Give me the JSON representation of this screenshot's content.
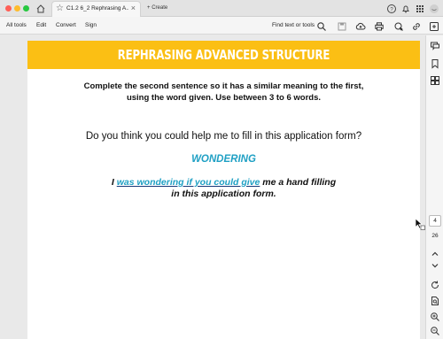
{
  "browser": {
    "tab_title": "C1.2 6_2 Rephrasing A...",
    "create_label": "Create"
  },
  "menu": {
    "all_tools": "All tools",
    "edit": "Edit",
    "convert": "Convert",
    "sign": "Sign",
    "find_placeholder": "Find text or tools"
  },
  "document": {
    "banner_title": "REPHRASING ADVANCED STRUCTURE",
    "instructions_line1": "Complete the second sentence so it has a similar meaning to the first,",
    "instructions_line2": "using the word given. Use between 3 to 6 words.",
    "question": "Do you think you could help me to fill in this application form?",
    "keyword": "WONDERING",
    "answer_start": "I ",
    "answer_fill": "was wondering if you could give",
    "answer_end": " me a hand filling",
    "answer_line2": "in this application form."
  },
  "pagination": {
    "current_page": "4",
    "total_pages": "26"
  },
  "colors": {
    "banner": "#fbbf14",
    "accent": "#1fa0c4"
  }
}
